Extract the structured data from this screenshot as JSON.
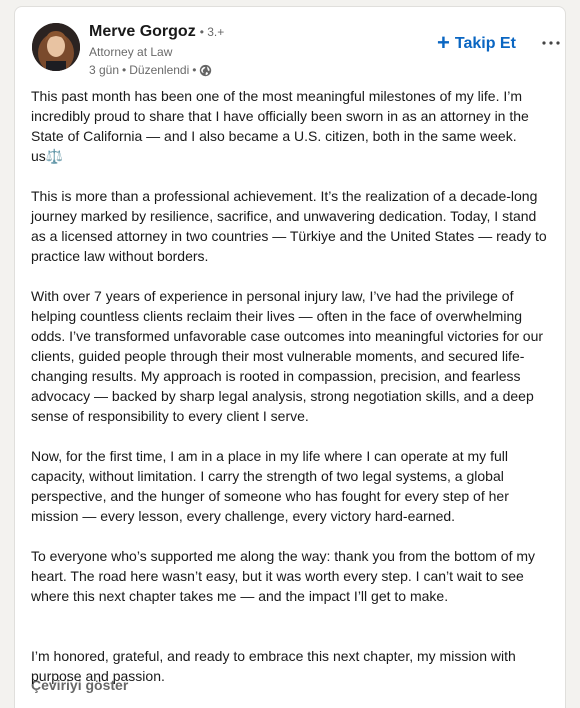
{
  "author": {
    "name": "Merve Gorgoz",
    "degree": "• 3.+",
    "headline": "Attorney at Law",
    "time": "3 gün",
    "separator": "•",
    "edited": "Düzenlendi",
    "visibility_icon": "globe-icon"
  },
  "actions": {
    "follow_icon": "plus-icon",
    "follow_label": "Takip Et",
    "more_icon": "more-options-icon"
  },
  "post": {
    "paragraphs": [
      "This past month has been one of the most meaningful milestones of my life. I’m incredibly proud to share that I have officially been sworn in as an attorney in the State of California — and I also became a U.S. citizen, both in the same week. us⚖️",
      "This is more than a professional achievement. It’s the realization of a decade-long journey marked by resilience, sacrifice, and unwavering dedication. Today, I stand as a licensed attorney in two countries — Türkiye and the United States — ready to practice law without borders.",
      "With over 7 years of experience in personal injury law, I’ve had the privilege of helping countless clients reclaim their lives — often in the face of overwhelming odds. I’ve transformed unfavorable case outcomes into meaningful victories for our clients, guided people through their most vulnerable moments, and secured life-changing results. My approach is rooted in compassion, precision, and fearless advocacy — backed by sharp legal analysis, strong negotiation skills, and a deep sense of responsibility to every client I serve.",
      "Now, for the first time, I am in a place in my life where I can operate at my full capacity, without limitation. I carry the strength of two legal systems, a global perspective, and the hunger of someone who has fought for every step of her mission — every lesson, every challenge, every victory hard-earned.",
      "To everyone who’s supported me along the way: thank you from the bottom of my heart. The road here wasn’t easy, but it was worth every step. I can’t wait to see where this next chapter takes me — and the impact I’ll get to make.",
      "I’m honored, grateful, and ready to embrace this next chapter, my mission with purpose and passion."
    ]
  },
  "translate_label": "Çeviriyi göster",
  "colors": {
    "accent": "#0a66c2",
    "secondary_text": "#666666",
    "background": "#f3f2ef"
  }
}
